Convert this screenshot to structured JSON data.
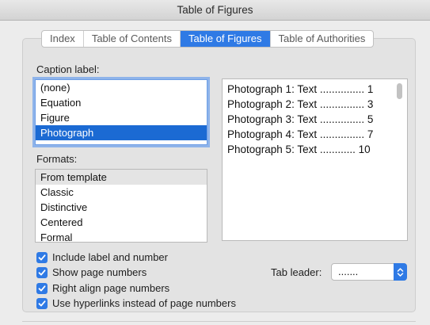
{
  "window": {
    "title": "Table of Figures"
  },
  "tabs": [
    {
      "label": "Index"
    },
    {
      "label": "Table of Contents"
    },
    {
      "label": "Table of Figures"
    },
    {
      "label": "Table of Authorities"
    }
  ],
  "caption": {
    "label": "Caption label:",
    "items": [
      "(none)",
      "Equation",
      "Figure",
      "Photograph"
    ],
    "selected": "Photograph"
  },
  "formats": {
    "label": "Formats:",
    "items": [
      "From template",
      "Classic",
      "Distinctive",
      "Centered",
      "Formal"
    ],
    "highlighted": "From template"
  },
  "preview": {
    "lines": [
      "Photograph 1: Text ............... 1",
      "Photograph 2: Text ............... 3",
      "Photograph 3: Text ............... 5",
      "Photograph 4: Text ............... 7",
      "Photograph 5: Text ............ 10"
    ]
  },
  "options": [
    {
      "label": "Include label and number",
      "checked": true
    },
    {
      "label": "Show page numbers",
      "checked": true
    },
    {
      "label": "Right align page numbers",
      "checked": true
    },
    {
      "label": "Use hyperlinks instead of page numbers",
      "checked": true
    }
  ],
  "tab_leader": {
    "label": "Tab leader:",
    "value": "......."
  },
  "colors": {
    "accent": "#2f7ae5",
    "selection": "#1b6ad3"
  }
}
